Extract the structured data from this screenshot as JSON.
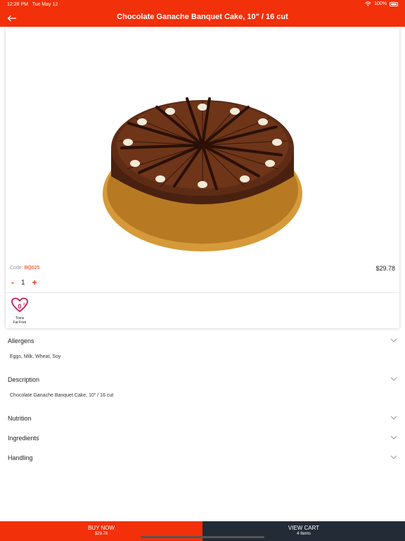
{
  "status_bar": {
    "time": "12:28 PM",
    "date": "Tue May 12",
    "battery": "100%"
  },
  "header": {
    "title": "Chocolate Ganache Banquet Cake, 10\" / 16 cut"
  },
  "product": {
    "code_label": "Code:",
    "code": "BQ025",
    "price": "$29.78",
    "quantity": "1",
    "minus_label": "-",
    "plus_label": "+",
    "badge": {
      "value": "0",
      "unit": "g",
      "line1": "Trans",
      "line2": "Fat Free"
    }
  },
  "sections": {
    "allergens": {
      "title": "Allergens",
      "body": "Eggs, Milk, Wheat, Soy"
    },
    "description": {
      "title": "Description",
      "body": "Chocolate Ganache Banquet Cake, 10\" / 16 cut"
    },
    "nutrition": {
      "title": "Nutrition"
    },
    "ingredients": {
      "title": "Ingredients"
    },
    "handling": {
      "title": "Handling"
    }
  },
  "footer": {
    "buy_label": "BUY NOW",
    "buy_price": "$29.78",
    "cart_label": "VIEW CART",
    "cart_count": "4 Items"
  },
  "colors": {
    "brand": "#f2300a",
    "dark": "#222b36"
  },
  "icons": [
    "wifi-icon",
    "battery-icon",
    "back-arrow-icon",
    "heart-icon",
    "chevron-down-icon"
  ]
}
